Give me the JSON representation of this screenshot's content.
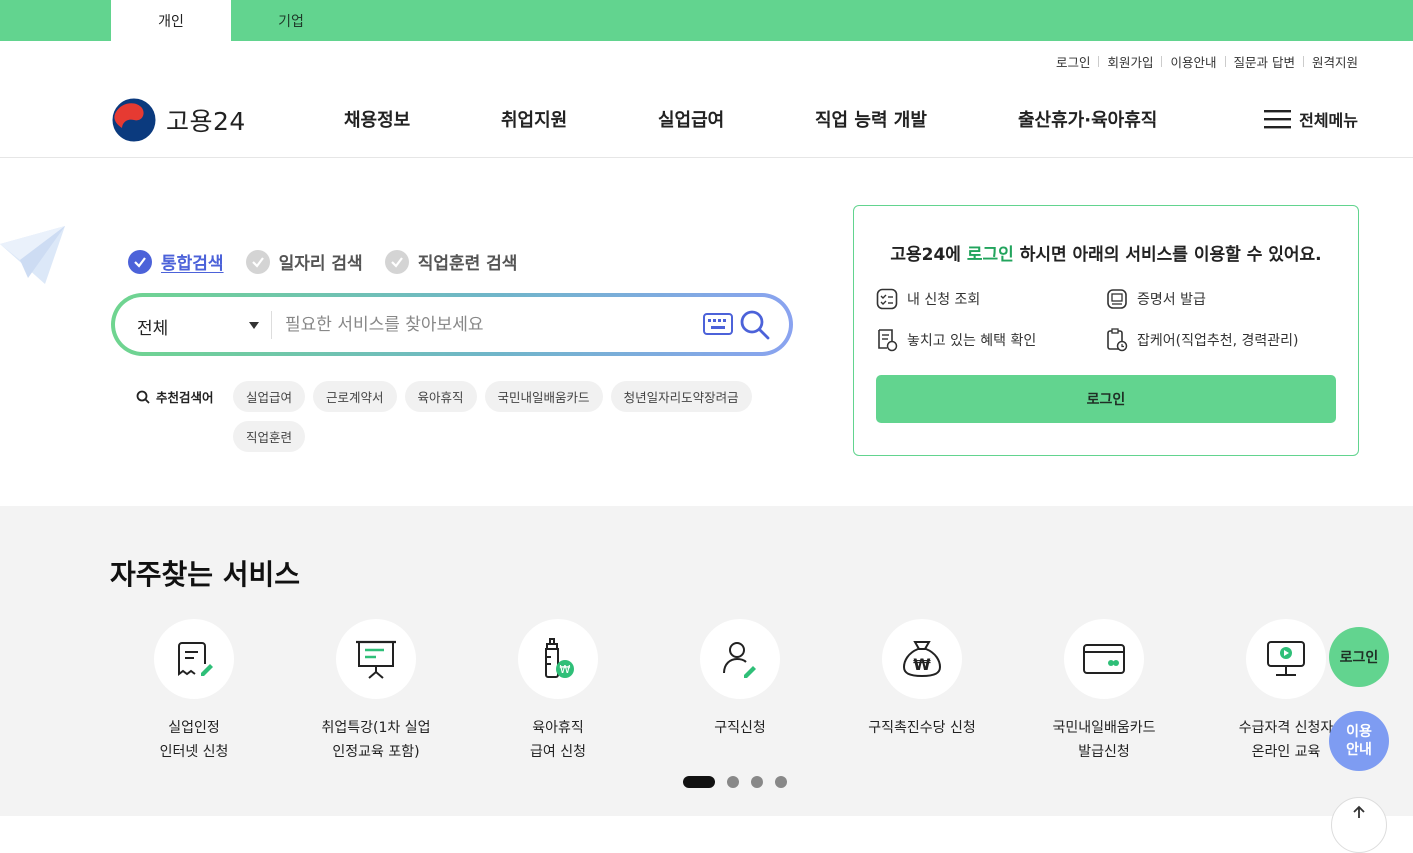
{
  "top_tabs": [
    "개인",
    "기업"
  ],
  "util_links": [
    "로그인",
    "회원가입",
    "이용안내",
    "질문과 답변",
    "원격지원"
  ],
  "logo": {
    "text": "고용24"
  },
  "gnb": [
    "채용정보",
    "취업지원",
    "실업급여",
    "직업 능력 개발",
    "출산휴가·육아휴직"
  ],
  "all_menu": "전체메뉴",
  "search": {
    "tabs": [
      "통합검색",
      "일자리 검색",
      "직업훈련 검색"
    ],
    "category": "전체",
    "placeholder": "필요한 서비스를 찾아보세요",
    "recommend_label": "추천검색어",
    "keywords": [
      "실업급여",
      "근로계약서",
      "육아휴직",
      "국민내일배움카드",
      "청년일자리도약장려금",
      "직업훈련"
    ]
  },
  "login_box": {
    "title_pre": "고용24에 ",
    "title_hl": "로그인",
    "title_post": " 하시면 아래의 서비스를 이용할 수 있어요.",
    "items": [
      "내 신청 조회",
      "증명서 발급",
      "놓치고 있는 혜택 확인",
      "잡케어(직업추천, 경력관리)"
    ],
    "button": "로그인"
  },
  "frequent": {
    "title": "자주찾는 서비스",
    "services": [
      {
        "label": "실업인정\n인터넷 신청",
        "icon": "document-edit-icon"
      },
      {
        "label": "취업특강(1차 실업\n인정교육 포함)",
        "icon": "presentation-board-icon"
      },
      {
        "label": "육아휴직\n급여 신청",
        "icon": "baby-bottle-icon"
      },
      {
        "label": "구직신청",
        "icon": "person-edit-icon"
      },
      {
        "label": "구직촉진수당 신청",
        "icon": "money-bag-icon"
      },
      {
        "label": "국민내일배움카드\n발급신청",
        "icon": "card-icon"
      },
      {
        "label": "수급자격 신청자\n온라인 교육",
        "icon": "monitor-play-icon"
      }
    ]
  },
  "fab": {
    "login": "로그인",
    "guide": "이용\n안내"
  },
  "colors": {
    "brand_green": "#62d48f",
    "accent_blue": "#4c62d9",
    "highlight_green": "#22a45d",
    "guide_blue": "#7e9cf2"
  }
}
